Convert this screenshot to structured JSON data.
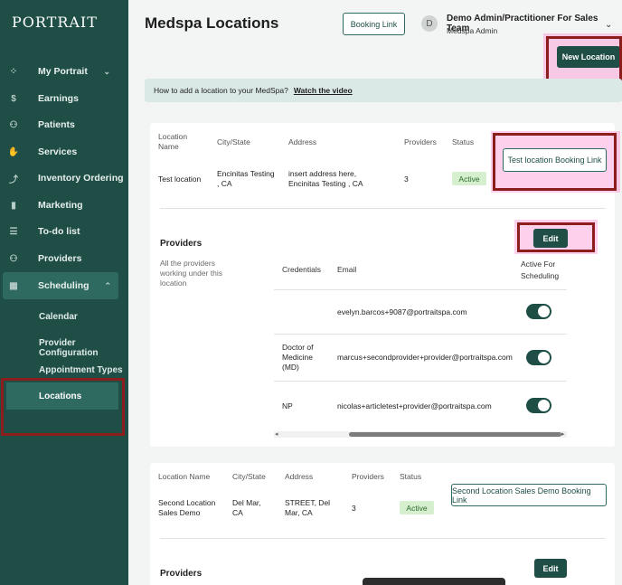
{
  "brand": {
    "logo": "PORTRAIT"
  },
  "sidebar": {
    "items": [
      {
        "label": "My Portrait",
        "icon": "my-portrait-icon",
        "glyph": "⁘",
        "chevron": "⌄"
      },
      {
        "label": "Earnings",
        "icon": "dollar-icon",
        "glyph": "$"
      },
      {
        "label": "Patients",
        "icon": "patients-icon",
        "glyph": "⚇"
      },
      {
        "label": "Services",
        "icon": "services-icon",
        "glyph": "✋"
      },
      {
        "label": "Inventory Ordering",
        "icon": "inventory-icon",
        "glyph": "⤴"
      },
      {
        "label": "Marketing",
        "icon": "marketing-icon",
        "glyph": "▮"
      },
      {
        "label": "To-do list",
        "icon": "todo-icon",
        "glyph": "☰"
      },
      {
        "label": "Providers",
        "icon": "providers-icon",
        "glyph": "⚇"
      },
      {
        "label": "Scheduling",
        "icon": "calendar-icon",
        "glyph": "▦",
        "chevron": "⌃"
      }
    ],
    "sub_items": [
      "Calendar",
      "Provider Configuration",
      "Appointment Types",
      "Locations"
    ]
  },
  "header": {
    "title": "Medspa Locations",
    "booking_link": "Booking Link",
    "avatar_initial": "D",
    "user_name": "Demo Admin/Practitioner For Sales Team",
    "user_role": "Medspa Admin",
    "user_chevron": "⌄",
    "new_location": "New Location"
  },
  "banner": {
    "text": "How to add a location to your MedSpa?",
    "link": "Watch the video"
  },
  "columns": {
    "location_name": "Location Name",
    "city_state": "City/State",
    "address": "Address",
    "providers": "Providers",
    "status": "Status"
  },
  "location1": {
    "name": "Test location",
    "city": "Encinitas Testing , CA",
    "address": "insert address here, Encinitas Testing , CA",
    "providers": "3",
    "status": "Active",
    "booking_button": "Test location Booking Link",
    "providers_title": "Providers",
    "providers_desc": "All the providers working under this location",
    "edit": "Edit",
    "table_headers": {
      "credentials": "Credentials",
      "email": "Email",
      "active": "Active For Scheduling"
    },
    "providers_list": [
      {
        "credentials": "",
        "email": "evelyn.barcos+9087@portraitspa.com",
        "active": true
      },
      {
        "credentials": "Doctor of Medicine (MD)",
        "email": "marcus+secondprovider+provider@portraitspa.com",
        "active": true
      },
      {
        "credentials": "NP",
        "email": "nicolas+articletest+provider@portraitspa.com",
        "active": true
      }
    ]
  },
  "location2": {
    "name": "Second Location Sales Demo",
    "city": "Del Mar, CA",
    "address": "STREET, Del Mar, CA",
    "providers": "3",
    "status": "Active",
    "booking_button": "Second Location Sales Demo Booking Link",
    "providers_title": "Providers",
    "edit": "Edit"
  },
  "scroll": {
    "left_arrow": "◂",
    "right_arrow": "▸"
  },
  "colors": {
    "sidebar": "#1f4e47",
    "accent": "#2f6a61",
    "active_badge": "#d5efcf",
    "highlight_box": "#8b1d1d"
  }
}
